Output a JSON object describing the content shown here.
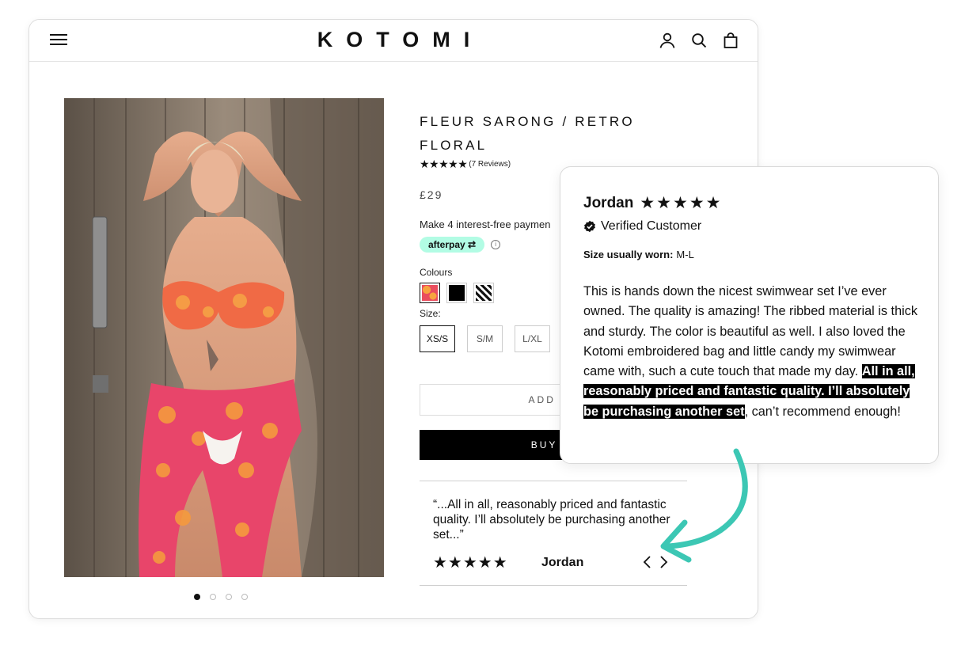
{
  "header": {
    "logo": "KOTOMI",
    "icons": [
      "menu-icon",
      "account-icon",
      "search-icon",
      "bag-icon"
    ]
  },
  "gallery": {
    "image_alt": "Model wearing retro floral bikini and sarong",
    "slides": 4,
    "active_slide": 1
  },
  "product": {
    "title": "FLEUR SARONG / RETRO FLORAL",
    "rating_stars": "★★★★★",
    "reviews_label": "(7 Reviews)",
    "price": "£29",
    "installments_text": "Make 4 interest-free paymen",
    "afterpay_label": "afterpay",
    "colours_label": "Colours",
    "size_label": "Size:",
    "sizes": [
      "XS/S",
      "S/M",
      "L/XL"
    ],
    "selected_size": "XS/S",
    "add_to_cart_label": "ADD TO",
    "buy_now_label": "BUY IT"
  },
  "review_snippet": {
    "quote": "“...All in all, reasonably priced and fantastic quality. I’ll absolutely be purchasing another set...”",
    "stars": "★★★★★",
    "author": "Jordan"
  },
  "review_card": {
    "author": "Jordan",
    "stars": "★★★★★",
    "verified_label": "Verified Customer",
    "size_worn_label": "Size usually worn:",
    "size_worn_value": "M-L",
    "body_start": "This is hands down the nicest swimwear set I’ve ever owned. The quality is amazing! The ribbed material is thick and sturdy. The color is beautiful as well. I also loved the Kotomi embroidered bag and little candy my swimwear came with, such a cute touch that made my day. ",
    "body_highlight": "All in all, reasonably priced and fantastic quality. I’ll absolutely be purchasing another set",
    "body_end": ", can’t recommend enough!"
  },
  "colors": {
    "accent_arrow": "#3cc7b4",
    "afterpay_bg": "#b2fce4",
    "primary": "#000000"
  }
}
